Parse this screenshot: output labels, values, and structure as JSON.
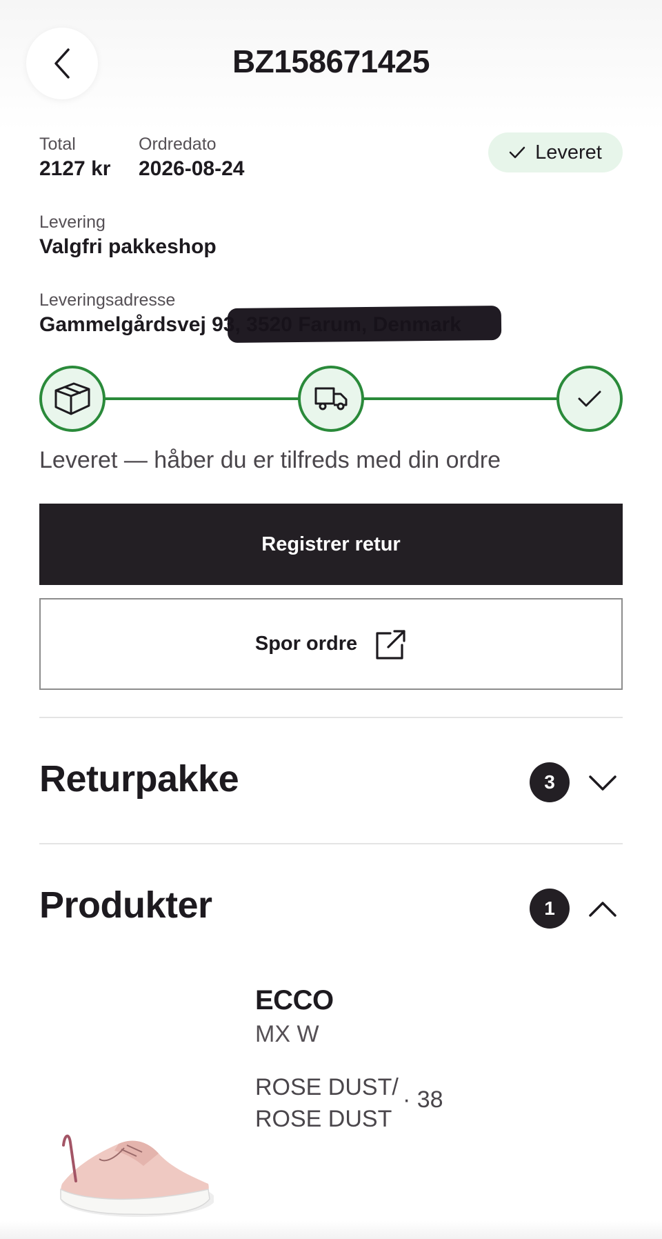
{
  "header": {
    "back_icon": "chevron-left-icon",
    "order_number": "BZ158671425"
  },
  "order": {
    "total_label": "Total",
    "total_value": "2127 kr",
    "date_label": "Ordredato",
    "date_value": "2026-08-24",
    "status": "Leveret",
    "delivery_label": "Levering",
    "delivery_value": "Valgfri pakkeshop",
    "address_label": "Leveringsadresse",
    "address_value": "Gammelgårdsvej 93, 3520 Farum, Denmark"
  },
  "tracker": {
    "steps": [
      {
        "icon": "package-icon",
        "done": true
      },
      {
        "icon": "truck-icon",
        "done": true
      },
      {
        "icon": "check-icon",
        "done": true
      }
    ],
    "message": "Leveret — håber du er tilfreds med din ordre"
  },
  "actions": {
    "register_return": "Registrer retur",
    "track_order": "Spor ordre"
  },
  "sections": {
    "return_package": {
      "title": "Returpakke",
      "count": "3",
      "expanded": false
    },
    "products": {
      "title": "Produkter",
      "count": "1",
      "expanded": true
    }
  },
  "product": {
    "brand": "ECCO",
    "model": "MX W",
    "color_line1": "ROSE DUST/",
    "color_line2": "ROSE DUST",
    "size": "· 38",
    "image_icon": "sneaker-image"
  },
  "colors": {
    "dark": "#231f24",
    "success": "#2a8a3a",
    "success_bg": "#e9f6ec"
  }
}
